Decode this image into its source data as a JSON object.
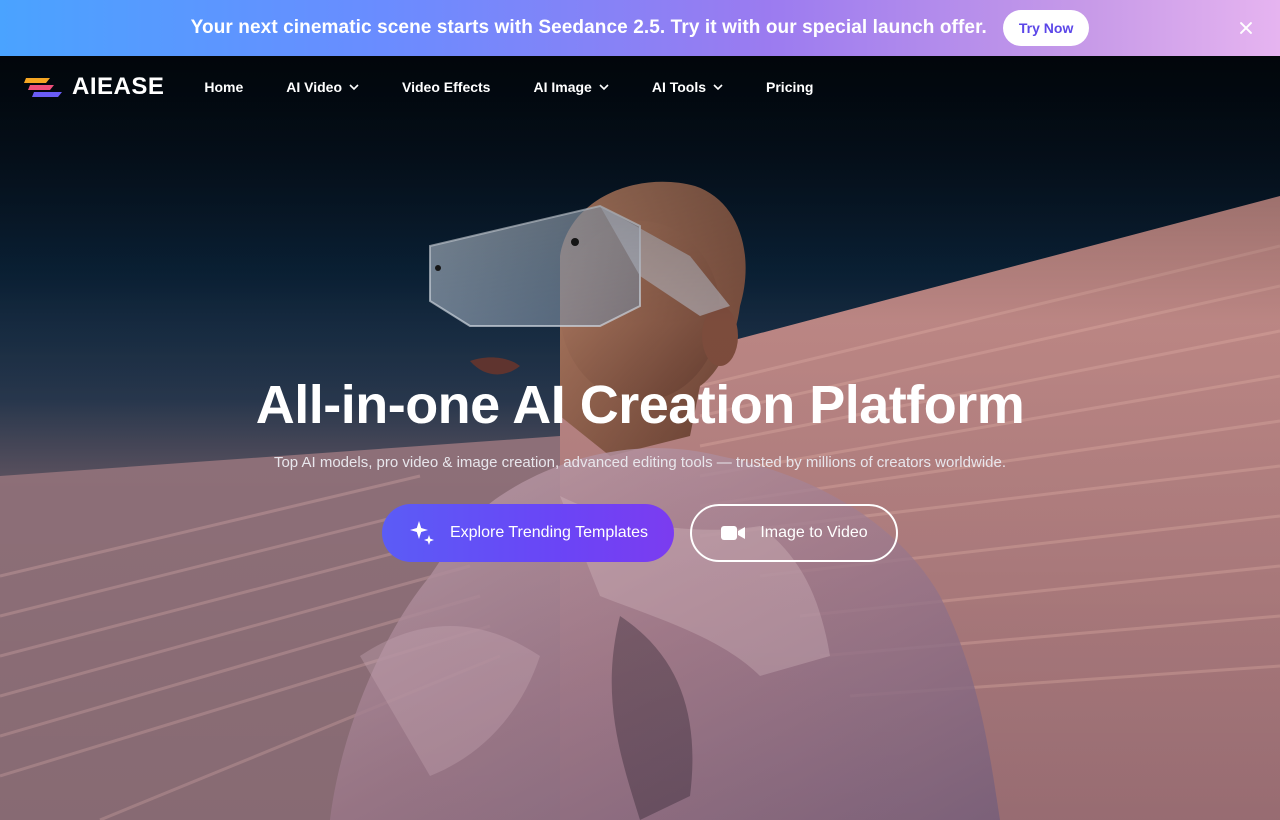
{
  "promo": {
    "text": "Your next cinematic scene starts with Seedance 2.5. Try it with our special launch offer.",
    "cta": "Try Now"
  },
  "brand": {
    "name": "AIEASE"
  },
  "nav": {
    "items": [
      {
        "label": "Home",
        "dropdown": false
      },
      {
        "label": "AI Video",
        "dropdown": true
      },
      {
        "label": "Video Effects",
        "dropdown": false
      },
      {
        "label": "AI Image",
        "dropdown": true
      },
      {
        "label": "AI Tools",
        "dropdown": true
      },
      {
        "label": "Pricing",
        "dropdown": false
      }
    ]
  },
  "hero": {
    "title": "All-in-one AI Creation Platform",
    "subtitle": "Top AI models, pro video & image creation, advanced editing tools — trusted by millions of creators worldwide.",
    "primary_cta": "Explore Trending Templates",
    "secondary_cta": "Image to Video"
  },
  "icons": {
    "close": "close-icon",
    "sparkle": "sparkle-icon",
    "video": "video-camera-icon",
    "chevron": "chevron-down-icon"
  },
  "colors": {
    "accent": "#6a45f6",
    "try_now_text": "#5b46e8"
  }
}
